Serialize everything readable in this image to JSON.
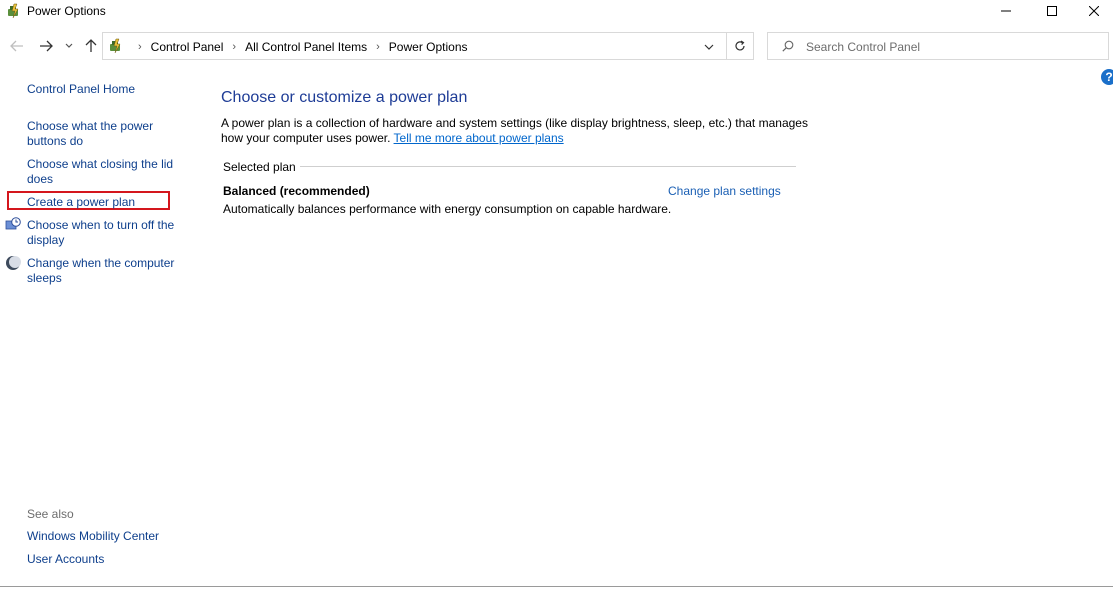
{
  "window": {
    "title": "Power Options"
  },
  "navigation": {
    "breadcrumbs": [
      "Control Panel",
      "All Control Panel Items",
      "Power Options"
    ]
  },
  "search": {
    "placeholder": "Search Control Panel"
  },
  "sidebar": {
    "home": "Control Panel Home",
    "links": [
      "Choose what the power buttons do",
      "Choose what closing the lid does",
      "Create a power plan",
      "Choose when to turn off the display",
      "Change when the computer sleeps"
    ],
    "see_also_label": "See also",
    "see_also": [
      "Windows Mobility Center",
      "User Accounts"
    ]
  },
  "main": {
    "title": "Choose or customize a power plan",
    "description": "A power plan is a collection of hardware and system settings (like display brightness, sleep, etc.) that manages how your computer uses power.",
    "learn_more": "Tell me more about power plans",
    "section_label": "Selected plan",
    "plan": {
      "name": "Balanced (recommended)",
      "change_link": "Change plan settings",
      "description": "Automatically balances performance with energy consumption on capable hardware."
    }
  },
  "colors": {
    "link": "#0e3f8c",
    "title": "#1e3c96",
    "highlight": "#d4161d"
  }
}
